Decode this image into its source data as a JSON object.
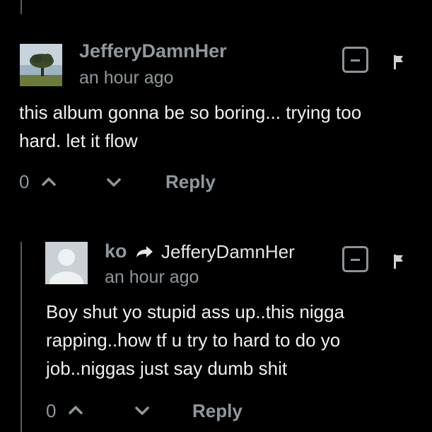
{
  "comments": [
    {
      "author": "JefferyDamnHer",
      "time": "an hour ago",
      "body": "this album gonna be so boring... trying too hard. let it flow",
      "votes": "0",
      "reply_label": "Reply"
    },
    {
      "author": "ko",
      "reply_to": "JefferyDamnHer",
      "time": "an hour ago",
      "body": "Boy shut yo stupid ass up..this nigga rapping..how tf u try to hard to do yo job..niggas just say dumb shit",
      "votes": "0",
      "reply_label": "Reply"
    }
  ],
  "colors": {
    "background": "#000000",
    "meta_text": "#8f989e",
    "body_text": "#f0f0f0",
    "thread_line": "#5b5b5b"
  },
  "icons": [
    "collapse-icon",
    "flag-icon",
    "upvote-chevron-icon",
    "downvote-chevron-icon",
    "reply-arrow-icon",
    "avatar-landscape",
    "avatar-default-user"
  ]
}
